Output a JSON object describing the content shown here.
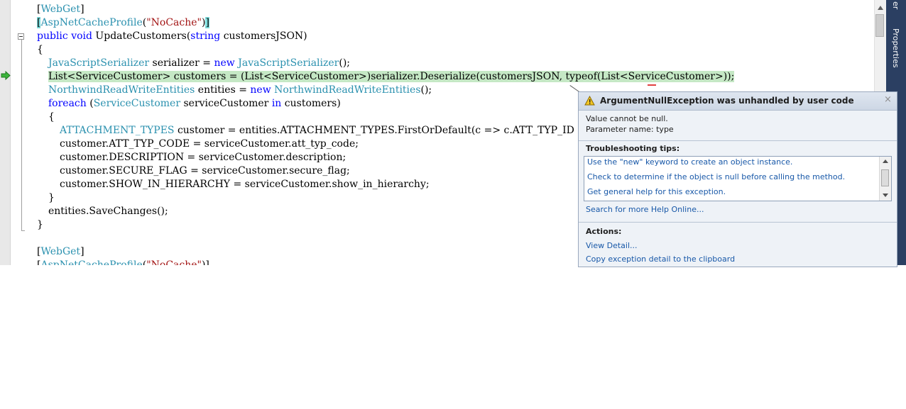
{
  "code": {
    "lines": [
      {
        "indent": 52,
        "segs": [
          {
            "t": "[",
            "c": "pl"
          },
          {
            "t": "WebGet",
            "c": "ty"
          },
          {
            "t": "]",
            "c": "pl"
          }
        ]
      },
      {
        "indent": 52,
        "segs": [
          {
            "t": "[",
            "c": "brk"
          },
          {
            "t": "AspNetCacheProfile",
            "c": "ty"
          },
          {
            "t": "(",
            "c": "pl"
          },
          {
            "t": "\"NoCache\"",
            "c": "st"
          },
          {
            "t": ")",
            "c": "pl"
          },
          {
            "t": "]",
            "c": "brk"
          }
        ]
      },
      {
        "indent": 52,
        "segs": [
          {
            "t": "public",
            "c": "kw"
          },
          {
            "t": " ",
            "c": "pl"
          },
          {
            "t": "void",
            "c": "kw"
          },
          {
            "t": " UpdateCustomers(",
            "c": "pl"
          },
          {
            "t": "string",
            "c": "kw"
          },
          {
            "t": " customersJSON)",
            "c": "pl"
          }
        ]
      },
      {
        "indent": 52,
        "segs": [
          {
            "t": "{",
            "c": "pl"
          }
        ]
      },
      {
        "indent": 68,
        "segs": [
          {
            "t": "JavaScriptSerializer",
            "c": "ty"
          },
          {
            "t": " serializer = ",
            "c": "pl"
          },
          {
            "t": "new",
            "c": "kw"
          },
          {
            "t": " ",
            "c": "pl"
          },
          {
            "t": "JavaScriptSerializer",
            "c": "ty"
          },
          {
            "t": "();",
            "c": "pl"
          }
        ]
      },
      {
        "indent": 68,
        "highlight": true,
        "segs": [
          {
            "t": "List<ServiceCustomer> customers = (List<ServiceCustomer>)serializer.Deserialize(customersJSON, typeof(List<ServiceCustomer>));",
            "c": "pl"
          }
        ]
      },
      {
        "indent": 68,
        "segs": [
          {
            "t": "NorthwindReadWriteEntities",
            "c": "ty"
          },
          {
            "t": " entities = ",
            "c": "pl"
          },
          {
            "t": "new",
            "c": "kw"
          },
          {
            "t": " ",
            "c": "pl"
          },
          {
            "t": "NorthwindReadWriteEntities",
            "c": "ty"
          },
          {
            "t": "();",
            "c": "pl"
          }
        ]
      },
      {
        "indent": 68,
        "segs": [
          {
            "t": "foreach",
            "c": "kw"
          },
          {
            "t": " (",
            "c": "pl"
          },
          {
            "t": "ServiceCustomer",
            "c": "ty"
          },
          {
            "t": " serviceCustomer ",
            "c": "pl"
          },
          {
            "t": "in",
            "c": "kw"
          },
          {
            "t": " customers)",
            "c": "pl"
          }
        ]
      },
      {
        "indent": 68,
        "segs": [
          {
            "t": "{",
            "c": "pl"
          }
        ]
      },
      {
        "indent": 84,
        "segs": [
          {
            "t": "ATTACHMENT_TYPES",
            "c": "ty"
          },
          {
            "t": " customer = entities.ATTACHMENT_TYPES.FirstOrDefault(c => c.ATT_TYP_ID == servic",
            "c": "pl"
          }
        ]
      },
      {
        "indent": 84,
        "segs": [
          {
            "t": "customer.ATT_TYP_CODE = serviceCustomer.att_typ_code;",
            "c": "pl"
          }
        ]
      },
      {
        "indent": 84,
        "segs": [
          {
            "t": "customer.DESCRIPTION = serviceCustomer.description;",
            "c": "pl"
          }
        ]
      },
      {
        "indent": 84,
        "segs": [
          {
            "t": "customer.SECURE_FLAG = serviceCustomer.secure_flag;",
            "c": "pl"
          }
        ]
      },
      {
        "indent": 84,
        "segs": [
          {
            "t": "customer.SHOW_IN_HIERARCHY = serviceCustomer.show_in_hierarchy;",
            "c": "pl"
          }
        ]
      },
      {
        "indent": 68,
        "segs": [
          {
            "t": "}",
            "c": "pl"
          }
        ]
      },
      {
        "indent": 68,
        "segs": [
          {
            "t": "entities.SaveChanges();",
            "c": "pl"
          }
        ]
      },
      {
        "indent": 52,
        "segs": [
          {
            "t": "}",
            "c": "pl"
          }
        ]
      },
      {
        "indent": 52,
        "segs": []
      },
      {
        "indent": 52,
        "segs": [
          {
            "t": "[",
            "c": "pl"
          },
          {
            "t": "WebGet",
            "c": "ty"
          },
          {
            "t": "]",
            "c": "pl"
          }
        ]
      },
      {
        "indent": 52,
        "segs": [
          {
            "t": "[",
            "c": "pl"
          },
          {
            "t": "AspNetCacheProfile",
            "c": "ty"
          },
          {
            "t": "(",
            "c": "pl"
          },
          {
            "t": "\"NoCache\"",
            "c": "st"
          },
          {
            "t": ")]",
            "c": "pl"
          }
        ]
      }
    ]
  },
  "side_panel": {
    "tab1": "er",
    "tab2": "Properties"
  },
  "exception": {
    "title": "ArgumentNullException was unhandled by user code",
    "close_glyph": "×",
    "message_line1": "Value cannot be null.",
    "message_line2": "Parameter name: type",
    "tips_heading": "Troubleshooting tips:",
    "tips": [
      "Use the \"new\" keyword to create an object instance.",
      "Check to determine if the object is null before calling the method.",
      "Get general help for this exception."
    ],
    "search_link": "Search for more Help Online...",
    "actions_heading": "Actions:",
    "actions": [
      "View Detail...",
      "Copy exception detail to the clipboard"
    ]
  },
  "colors": {
    "keyword": "#0000ff",
    "type": "#2b91af",
    "string": "#a31515",
    "current_line": "#c5e8c5",
    "link": "#1858a8"
  }
}
